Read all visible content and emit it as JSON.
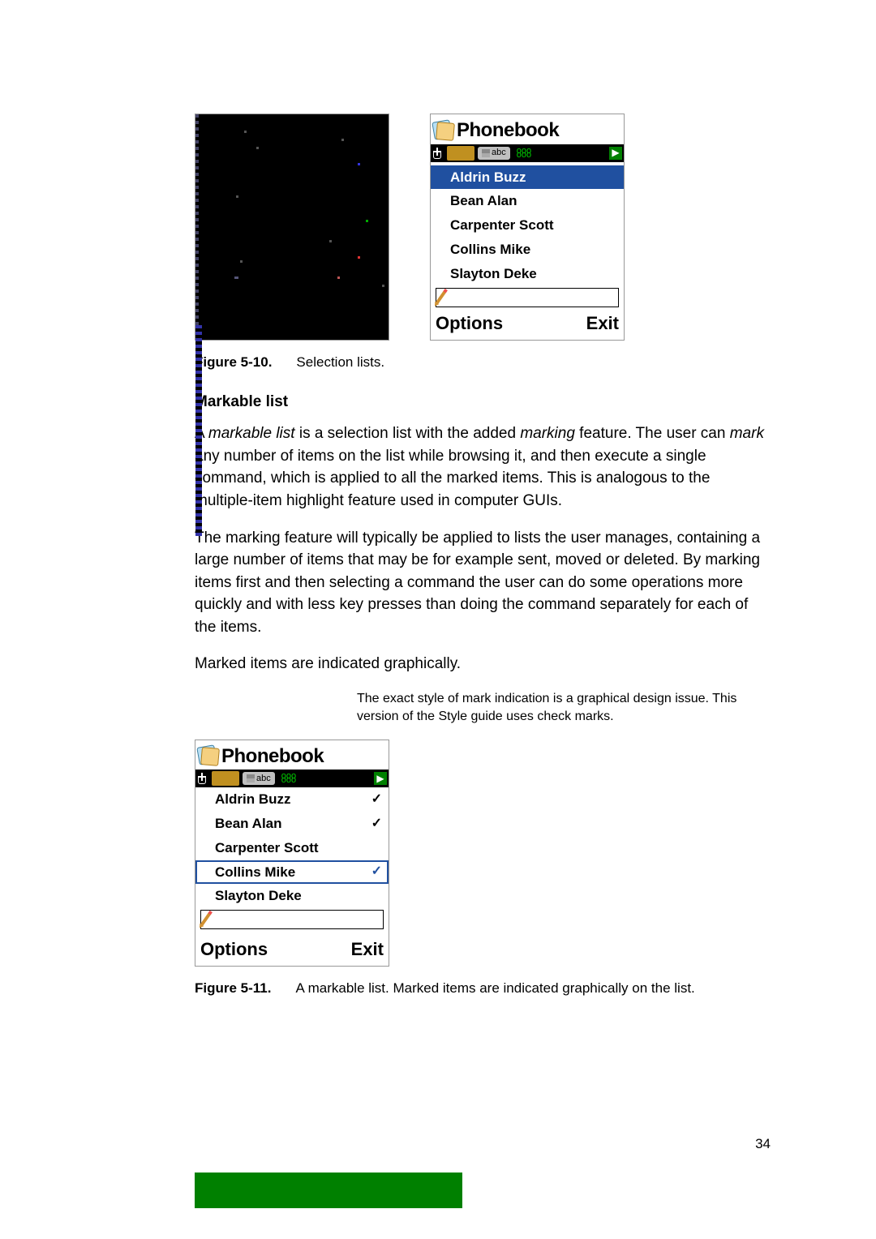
{
  "figure1": {
    "phone": {
      "title": "Phonebook",
      "tab_abc": "abc",
      "items": [
        "Aldrin Buzz",
        "Bean Alan",
        "Carpenter Scott",
        "Collins Mike",
        "Slayton Deke"
      ],
      "selected_index": 0,
      "softkey_left": "Options",
      "softkey_right": "Exit"
    },
    "caption_label": "Figure 5-10.",
    "caption_text": "Selection lists."
  },
  "section": {
    "heading": "Markable list",
    "para1_pre": "A ",
    "para1_em1": "markable list",
    "para1_mid1": " is a selection list with the added ",
    "para1_em2": "marking",
    "para1_mid2": " feature. The user can ",
    "para1_em3": "mark",
    "para1_post": " any number of items on the list while browsing it, and then execute a single command, which is applied to all the marked items. This is analogous to the multiple-item highlight feature used in computer GUIs.",
    "para2": "The marking feature will typically be applied to lists the user manages, containing a large number of items that may be for example sent, moved or deleted. By marking items first and then selecting a command the user can do some operations more quickly and with less key presses than doing the command separately for each of the items.",
    "para3": "Marked items are indicated graphically.",
    "side_note": "The exact style of mark indication is a graphical design issue. This version of the Style guide uses check marks."
  },
  "figure2": {
    "phone": {
      "title": "Phonebook",
      "tab_abc": "abc",
      "items": [
        {
          "label": "Aldrin Buzz",
          "checked": true
        },
        {
          "label": "Bean Alan",
          "checked": true
        },
        {
          "label": "Carpenter Scott",
          "checked": false
        },
        {
          "label": "Collins Mike",
          "checked": true
        },
        {
          "label": "Slayton Deke",
          "checked": false
        }
      ],
      "selected_index": 3,
      "softkey_left": "Options",
      "softkey_right": "Exit"
    },
    "caption_label": "Figure 5-11.",
    "caption_text": "A markable list. Marked items are indicated graphically on the list."
  },
  "page_number": "34"
}
